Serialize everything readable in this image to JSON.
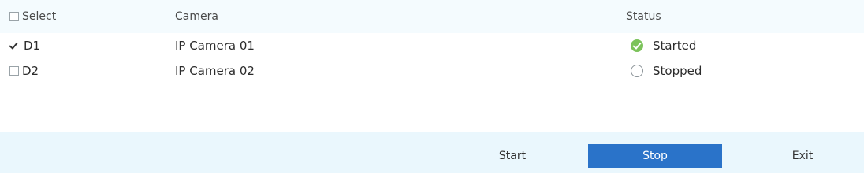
{
  "table": {
    "headers": {
      "select": "Select",
      "camera": "Camera",
      "status": "Status"
    },
    "rows": [
      {
        "id": "D1",
        "camera": "IP Camera 01",
        "status": "Started",
        "checked": true
      },
      {
        "id": "D2",
        "camera": "IP Camera 02",
        "status": "Stopped",
        "checked": false
      }
    ]
  },
  "buttons": {
    "start": "Start",
    "stop": "Stop",
    "exit": "Exit"
  },
  "colors": {
    "primary": "#2a73c9",
    "started": "#7cc35b",
    "panel": "#eaf7fd"
  },
  "icons": {
    "started": "check-circle-icon",
    "stopped": "empty-circle-icon",
    "checked": "checkmark-icon"
  }
}
